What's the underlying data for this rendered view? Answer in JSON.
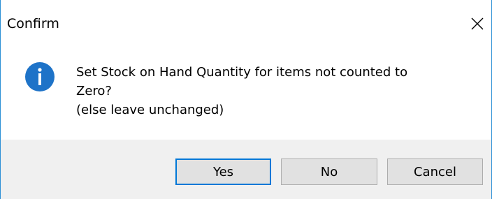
{
  "dialog": {
    "title": "Confirm",
    "close_icon": "close-icon",
    "message_icon": "info-icon",
    "message_lines": [
      "Set Stock on Hand Quantity for items not counted to",
      "Zero?",
      "(else leave unchanged)"
    ],
    "buttons": {
      "yes_label": "Yes",
      "no_label": "No",
      "cancel_label": "Cancel"
    },
    "accent_color": "#0078d7",
    "info_icon_color": "#1e73c8"
  }
}
